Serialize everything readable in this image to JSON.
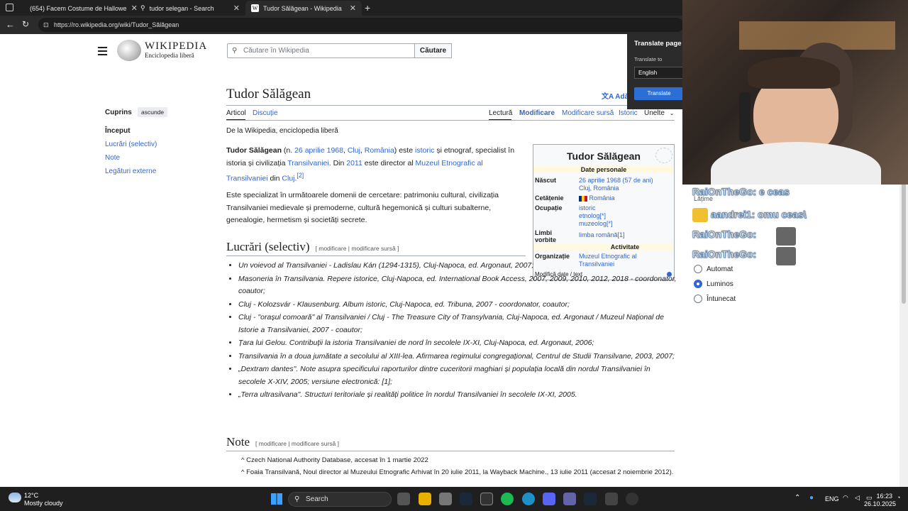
{
  "browser": {
    "tabs": [
      {
        "label": "(654) Facem Costume de Hallowe",
        "icon": "youtube-icon",
        "color": "#ff0000"
      },
      {
        "label": "tudor selegan - Search",
        "icon": "search-icon"
      },
      {
        "label": "Tudor Sălăgean - Wikipedia",
        "icon": "wikipedia-icon"
      }
    ],
    "url": "https://ro.wikipedia.org/wiki/Tudor_Sălăgean"
  },
  "wiki": {
    "wordmark": "Wikipedia",
    "tagline": "Enciclopedia liberă",
    "search_placeholder": "Căutare în Wikipedia",
    "search_button": "Căutare",
    "toc_title": "Cuprins",
    "toc_hide": "ascunde",
    "toc_items": [
      "Început",
      "Lucrări (selectiv)",
      "Note",
      "Legături externe"
    ],
    "title": "Tudor Sălăgean",
    "add_lang": "Adă",
    "tabs_left": [
      "Articol",
      "Discuție"
    ],
    "tabs_right": [
      "Lectură",
      "Modificare",
      "Modificare sursă",
      "Istoric",
      "Unelte"
    ],
    "from": "De la Wikipedia, enciclopedia liberă",
    "intro": {
      "name": "Tudor Sălăgean",
      "p1a": " (n. ",
      "birthdate": "26 aprilie 1968",
      "comma1": ", ",
      "city": "Cluj",
      "comma2": ", ",
      "country": "România",
      "p1b": ") este ",
      "istoric": "istoric",
      "p1c": " și etnograf, specialist în istoria și civilizația ",
      "transilvania": "Transilvaniei",
      "p1d": ". Din ",
      "year2011": "2011",
      "p1e": " este director al ",
      "muzeu": "Muzeul Etnografic al Transilvaniei",
      "p1f": " din ",
      "cluj2": "Cluj",
      "p1g": ".",
      "ref": "[2]",
      "p2": "Este specializat în următoarele domenii de cercetare: patrimoniu cultural, civilizația Transilvaniei medievale și premoderne, cultură hegemonică și culturi subalterne, genealogie, hermetism și societăți secrete."
    },
    "section_works": "Lucrări (selectiv)",
    "edit_links": "[ modificare | modificare sursă ]",
    "works": [
      "Un voievod al Transilvaniei - Ladislau Kán (1294-1315), Cluj-Napoca, ed. Argonaut, 2007;",
      "Masoneria în Transilvania. Repere istorice, Cluj-Napoca, ed. International Book Access, 2007, 2009, 2010, 2012, 2018 - coordonator, coautor;",
      "Cluj - Kolozsvár - Klausenburg. Album istoric, Cluj-Napoca, ed. Tribuna, 2007 - coordonator, coautor;",
      "Cluj - \"orașul comoară\" al Transilvaniei / Cluj - The Treasure City of Transylvania, Cluj-Napoca, ed. Argonaut / Muzeul Național de Istorie a Transilvaniei, 2007 - coautor;",
      "Țara lui Gelou. Contribuții la istoria Transilvaniei de nord în secolele IX-XI, Cluj-Napoca, ed. Argonaut, 2006;",
      "Transilvania în a doua jumătate a secolului al XIII-lea. Afirmarea regimului congregațional, Centrul de Studii Transilvane, 2003, 2007;",
      "„Dextram dantes\". Note asupra specificului raporturilor dintre cuceritorii maghiari și populația locală din nordul Transilvaniei în secolele X-XIV, 2005; versiune electronică: [1];",
      "„Terra ultrasilvana\". Structuri teritoriale și realități politice în nordul Transilvaniei în secolele IX-XI, 2005."
    ],
    "section_notes": "Note",
    "notes": [
      "^ Czech National Authority Database, accesat în 1 martie 2022",
      "^ Foaia Transilvană, Noul director al Muzeului Etnografic Arhivat în 20 iulie 2011, la Wayback Machine., 13 iulie 2011 (accesat 2 noiembrie 2012)."
    ],
    "infobox": {
      "title": "Tudor Sălăgean",
      "section1": "Date personale",
      "born_label": "Născut",
      "born_value": "26 aprilie 1968 (57 de ani)",
      "born_place": "Cluj, România",
      "cit_label": "Cetățenie",
      "cit_value": "România",
      "occ_label": "Ocupație",
      "occ_values": [
        "istoric",
        "etnolog[*]",
        "muzeolog[*]"
      ],
      "lang_label": "Limbi vorbite",
      "lang_value": "limba română[1]",
      "section2": "Activitate",
      "org_label": "Organizație",
      "org_value": "Muzeul Etnografic al Transilvaniei",
      "footer": "Modifică date / text"
    }
  },
  "translate_popup": {
    "title": "Translate page",
    "to_label": "Translate to",
    "language": "English",
    "button": "Translate"
  },
  "overlay": {
    "chat": [
      "RaiOnTheGo: e ceas",
      "aandrei1: omu ceas\\",
      "RaiOnTheGo:",
      "RaiOnTheGo:"
    ],
    "latime": "Lățime",
    "theme_options": [
      "Automat",
      "Luminos",
      "Întunecat"
    ],
    "theme_selected": "Luminos"
  },
  "taskbar": {
    "weather_temp": "12°C",
    "weather_desc": "Mostly cloudy",
    "search": "Search",
    "lang": "ENG",
    "time": "16:23",
    "date": "26.10.2025"
  }
}
